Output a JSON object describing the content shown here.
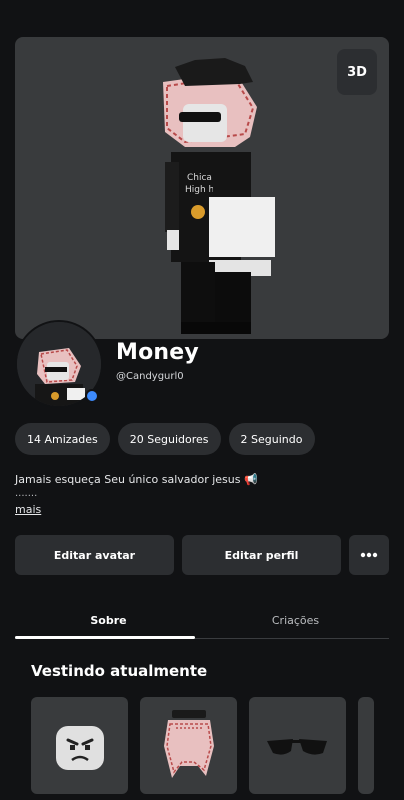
{
  "stage": {
    "view_toggle_label": "3D"
  },
  "profile": {
    "display_name": "Money",
    "username": "@Candygurl0",
    "online_color": "#3d8bfd"
  },
  "stats": [
    {
      "label": "14 Amizades"
    },
    {
      "label": "20 Seguidores"
    },
    {
      "label": "2 Seguindo"
    }
  ],
  "bio": {
    "text": "Jamais esqueça Seu único salvador jesus 📢",
    "extra_line": ".......",
    "more_link": "mais"
  },
  "actions": {
    "edit_avatar": "Editar avatar",
    "edit_profile": "Editar perfil",
    "more_icon": "more-horizontal-icon"
  },
  "tabs": [
    {
      "label": "Sobre",
      "active": true
    },
    {
      "label": "Criações",
      "active": false
    }
  ],
  "wearing": {
    "title": "Vestindo atualmente",
    "items": [
      {
        "name": "face-item"
      },
      {
        "name": "keffiyeh-item"
      },
      {
        "name": "sunglasses-item"
      }
    ]
  }
}
